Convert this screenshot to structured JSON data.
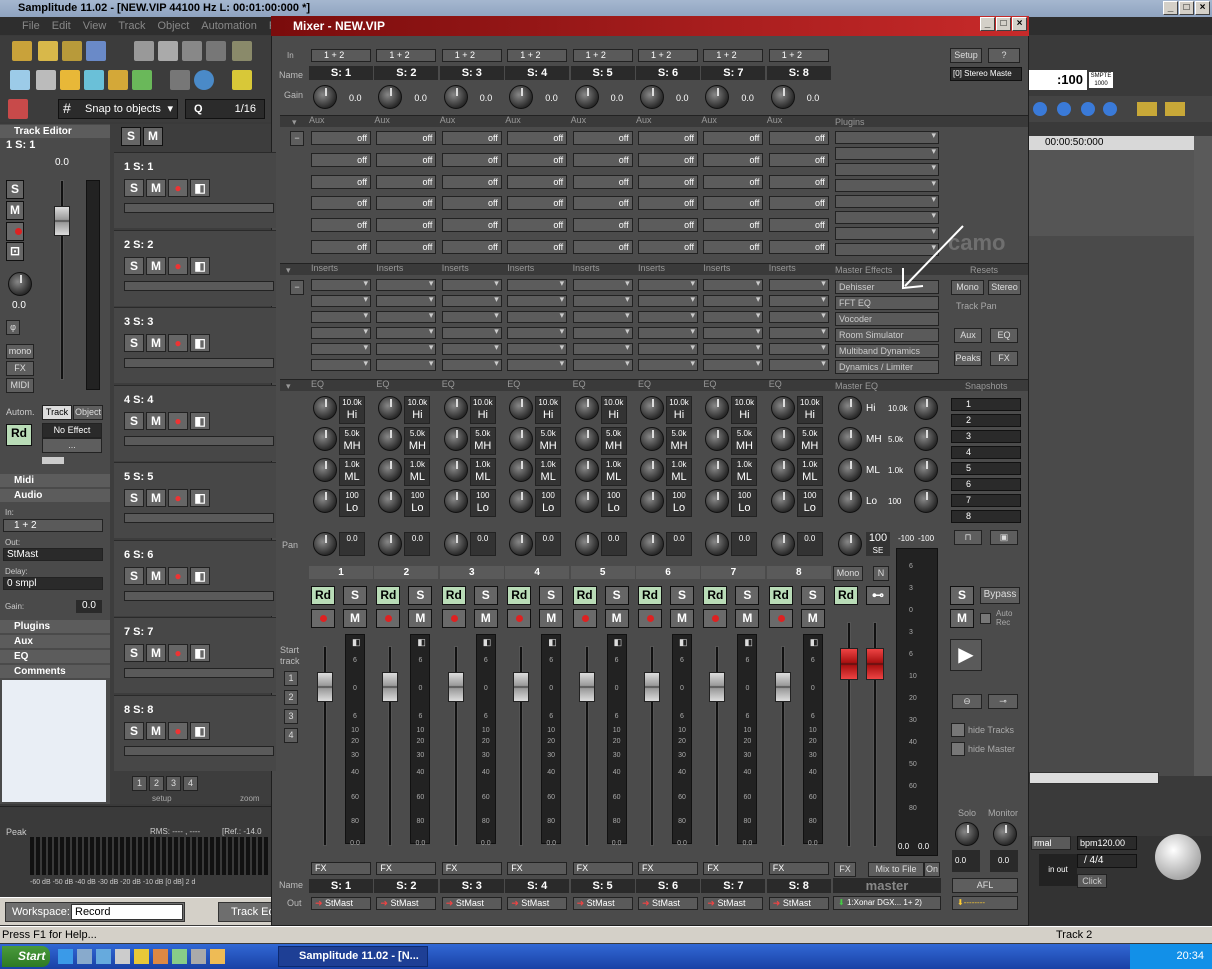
{
  "app": {
    "title": "Samplitude 11.02 - [NEW.VIP   44100 Hz L: 00:01:00:000 *]",
    "menu": [
      "File",
      "Edit",
      "View",
      "Track",
      "Object",
      "Automation",
      "Ran"
    ]
  },
  "toolbar": {
    "snap": "Snap to objects",
    "q_label": "Q",
    "q_value": "1/16"
  },
  "left": {
    "header": "Track Editor",
    "track": "1   S: 1",
    "value": "0.0",
    "pan": "0.0",
    "mono": "mono",
    "fx": "FX",
    "midi": "MIDI",
    "autom": "Autom.",
    "track_tab": "Track",
    "object_tab": "Object",
    "rd": "Rd",
    "no_effect": "No Effect",
    "dots": "...",
    "midi_sec": "Midi",
    "audio_sec": "Audio",
    "in_label": "In:",
    "in_val": "1 + 2",
    "out_label": "Out:",
    "out_val": "StMast",
    "delay_label": "Delay:",
    "delay_val": "0 smpl",
    "gain_label": "Gain:",
    "gain_val": "0.0",
    "plugins": "Plugins",
    "aux": "Aux",
    "eq": "EQ",
    "comments": "Comments"
  },
  "tracks": [
    {
      "label": "1   S: 1"
    },
    {
      "label": "2   S: 2"
    },
    {
      "label": "3   S: 3"
    },
    {
      "label": "4   S: 4"
    },
    {
      "label": "5   S: 5"
    },
    {
      "label": "6   S: 6"
    },
    {
      "label": "7   S: 7"
    },
    {
      "label": "8   S: 8"
    }
  ],
  "tracks_footer": {
    "setup": "setup",
    "zoom": "zoom",
    "nums": [
      "1",
      "2",
      "3",
      "4"
    ]
  },
  "mixer": {
    "title": "Mixer - NEW.VIP",
    "row_labels": {
      "in": "In",
      "name": "Name",
      "gain": "Gain",
      "pan": "Pan",
      "start_track": "Start track",
      "name2": "Name",
      "out": "Out"
    },
    "sections": {
      "aux": "Aux",
      "plugins": "Plugins",
      "inserts": "Inserts",
      "master_effects": "Master Effects",
      "resets": "Resets",
      "eq": "EQ",
      "master_eq": "Master EQ",
      "snapshots": "Snapshots"
    },
    "channels": [
      {
        "in": "1 + 2",
        "name": "S: 1",
        "gain": "0.0",
        "num": "1",
        "pan": "0.0",
        "out": "StMast"
      },
      {
        "in": "1 + 2",
        "name": "S: 2",
        "gain": "0.0",
        "num": "2",
        "pan": "0.0",
        "out": "StMast"
      },
      {
        "in": "1 + 2",
        "name": "S: 3",
        "gain": "0.0",
        "num": "3",
        "pan": "0.0",
        "out": "StMast"
      },
      {
        "in": "1 + 2",
        "name": "S: 4",
        "gain": "0.0",
        "num": "4",
        "pan": "0.0",
        "out": "StMast"
      },
      {
        "in": "1 + 2",
        "name": "S: 5",
        "gain": "0.0",
        "num": "5",
        "pan": "0.0",
        "out": "StMast"
      },
      {
        "in": "1 + 2",
        "name": "S: 6",
        "gain": "0.0",
        "num": "6",
        "pan": "0.0",
        "out": "StMast"
      },
      {
        "in": "1 + 2",
        "name": "S: 7",
        "gain": "0.0",
        "num": "7",
        "pan": "0.0",
        "out": "StMast"
      },
      {
        "in": "1 + 2",
        "name": "S: 8",
        "gain": "0.0",
        "num": "8",
        "pan": "0.0",
        "out": "StMast"
      }
    ],
    "aux_value": "off",
    "eq_bands": [
      {
        "freq": "10.0k",
        "band": "Hi"
      },
      {
        "freq": "5.0k",
        "band": "MH"
      },
      {
        "freq": "1.0k",
        "band": "ML"
      },
      {
        "freq": "100",
        "band": "Lo"
      }
    ],
    "buttons": {
      "rd": "Rd",
      "s": "S",
      "m": "M",
      "fx": "FX"
    },
    "meter_scale": [
      "6",
      "0",
      "6",
      "10",
      "20",
      "30",
      "40",
      "60",
      "80",
      "0.0"
    ],
    "start_nums": [
      "1",
      "2",
      "3",
      "4"
    ],
    "setup": "Setup",
    "help": "?",
    "stereo_master": "[0] Stereo Maste",
    "master_effects": [
      "Dehisser",
      "FFT EQ",
      "Vocoder",
      "Room Simulator",
      "Multiband Dynamics",
      "Dynamics / Limiter"
    ],
    "master_eq": [
      {
        "band": "Hi",
        "val": "10.0k"
      },
      {
        "band": "MH",
        "val": "5.0k"
      },
      {
        "band": "ML",
        "val": "1.0k"
      },
      {
        "band": "Lo",
        "val": "100"
      }
    ],
    "master_pan": "100",
    "master_se": "SE",
    "master_db": [
      "-100",
      "-100"
    ],
    "master_mono": "Mono",
    "master_n": "N",
    "master_name": "master",
    "mix_to_file": "Mix to File",
    "on": "On",
    "master_out": "1:Xonar DGX... 1+ 2)",
    "master_scale": [
      "6",
      "3",
      "0",
      "3",
      "6",
      "10",
      "20",
      "30",
      "40",
      "50",
      "60",
      "80"
    ],
    "master_readout": [
      "0.0",
      "0.0"
    ],
    "resets": {
      "mono": "Mono",
      "stereo": "Stereo",
      "track_pan": "Track Pan",
      "aux": "Aux",
      "eq": "EQ",
      "peaks": "Peaks",
      "fx": "FX"
    },
    "snapshots": [
      "1",
      "2",
      "3",
      "4",
      "5",
      "6",
      "7",
      "8"
    ],
    "bypass": "Bypass",
    "auto_rec": "Auto Rec",
    "hide_tracks": "hide Tracks",
    "hide_master": "hide Master",
    "solo": "Solo",
    "monitor": "Monitor",
    "solo_val": "0.0",
    "monitor_val": "0.0",
    "afl": "AFL",
    "afl_out": "--------"
  },
  "right": {
    "timecode": ":100",
    "smpte": "SMPTE 1000",
    "time": "00:00:50:000",
    "mode": "rmal",
    "bpm": "bpm120.00",
    "sig": "/ 4/4",
    "click": "Click",
    "inout": "in out"
  },
  "peak": {
    "label": "Peak",
    "rms": "RMS: ---- , ----",
    "ref": "[Ref.: -14.0",
    "scale": "-60 dB  -50 dB  -40 dB  -30 dB  -20 dB  -10 dB  [0 dB] 2 d"
  },
  "workspace": {
    "label": "Workspace:",
    "value": "Record",
    "track_ed": "Track Ed"
  },
  "status": {
    "help": "Press F1 for Help...",
    "track": "Track 2"
  },
  "taskbar": {
    "start": "Start",
    "app": "Samplitude 11.02 - [N...",
    "clock": "20:34"
  }
}
